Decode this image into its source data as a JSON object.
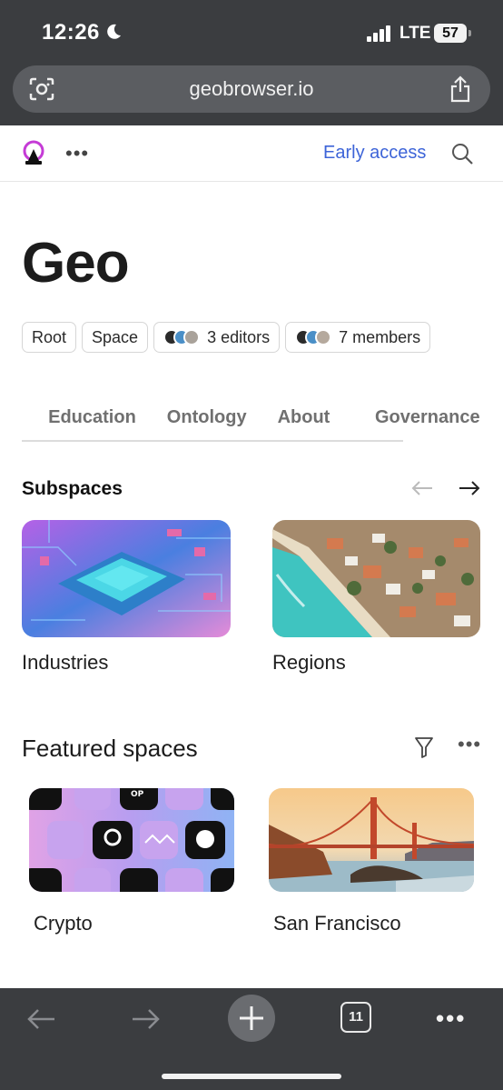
{
  "status": {
    "time": "12:26",
    "network": "LTE",
    "battery": "57"
  },
  "browser": {
    "url": "geobrowser.io",
    "tab_count": "11"
  },
  "header": {
    "early_access": "Early access"
  },
  "page": {
    "title": "Geo",
    "chips": {
      "root": "Root",
      "space": "Space",
      "editors": "3 editors",
      "members": "7 members"
    }
  },
  "tabs": {
    "partial": "v",
    "items": [
      "Education",
      "Ontology",
      "About",
      "Governance"
    ]
  },
  "subspaces": {
    "heading": "Subspaces",
    "cards": [
      {
        "label": "Industries"
      },
      {
        "label": "Regions"
      }
    ]
  },
  "featured": {
    "heading": "Featured spaces",
    "cards": [
      {
        "label": "Crypto"
      },
      {
        "label": "San Francisco"
      }
    ]
  },
  "colors": {
    "accent": "#3d64d8",
    "chrome": "#3b3d40"
  }
}
